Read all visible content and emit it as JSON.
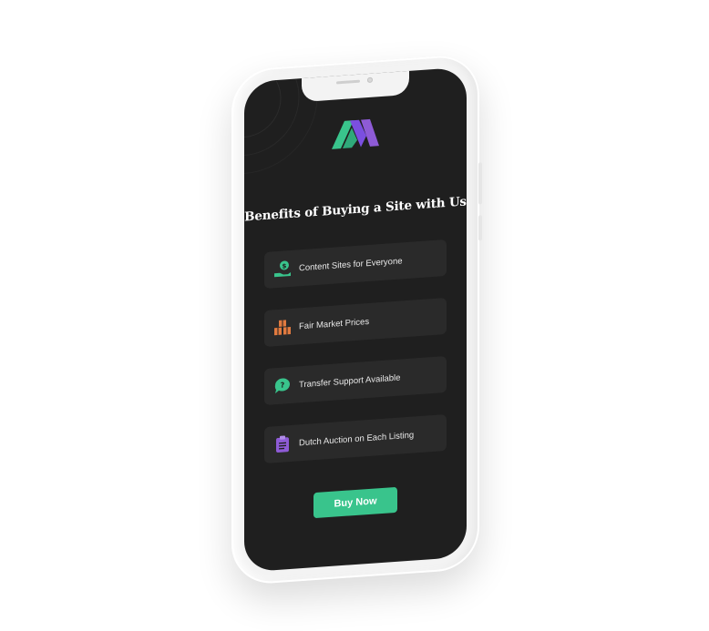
{
  "headline": "Benefits of Buying a Site with Us",
  "benefits": [
    {
      "label": "Content Sites for Everyone",
      "icon": "money-hand-icon",
      "color": "#39c48c"
    },
    {
      "label": "Fair Market Prices",
      "icon": "boxes-icon",
      "color": "#e07a3f"
    },
    {
      "label": "Transfer Support Available",
      "icon": "question-chat-icon",
      "color": "#39c48c"
    },
    {
      "label": "Dutch Auction on Each Listing",
      "icon": "clipboard-list-icon",
      "color": "#8e5bd6"
    }
  ],
  "cta": {
    "label": "Buy Now",
    "color": "#39c48c"
  },
  "logo": {
    "icon": "brand-logo-icon",
    "colors": [
      "#39c48c",
      "#7b4fe0"
    ]
  },
  "colors": {
    "screen_bg": "#1f1f1f",
    "card_bg": "#2a2a2a",
    "frame": "#f3f3f3"
  }
}
